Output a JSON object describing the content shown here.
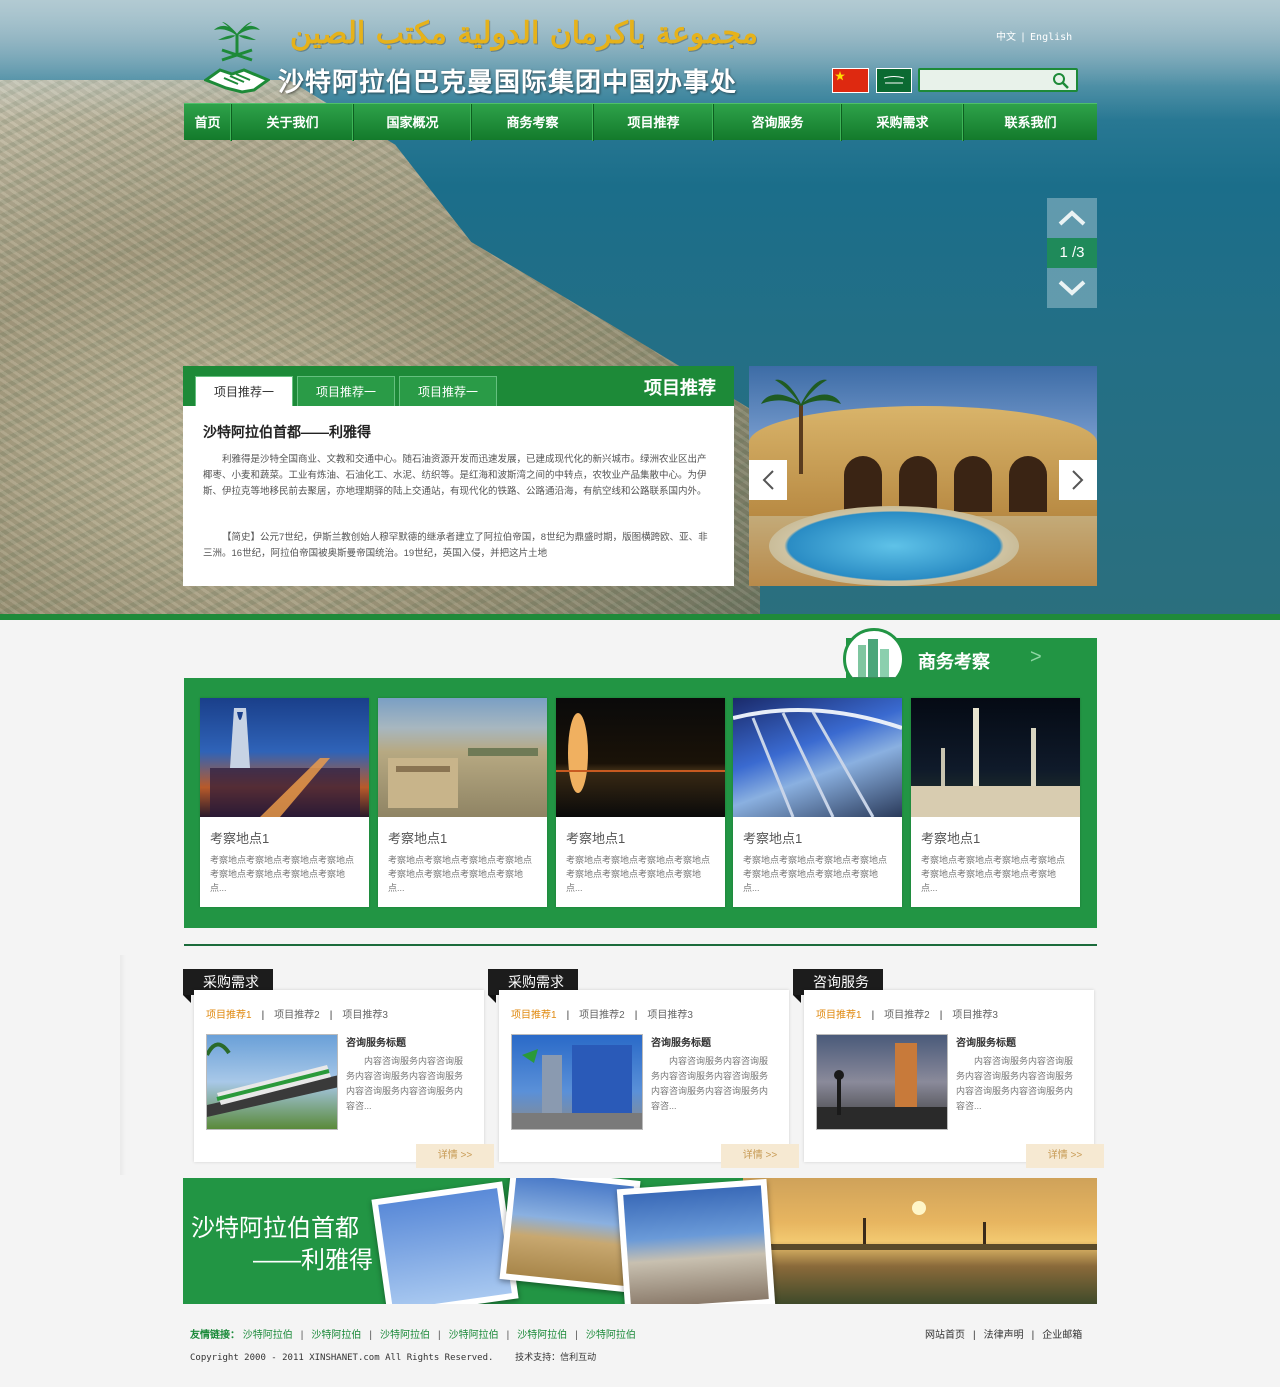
{
  "header": {
    "arabic_title": "مجموعة باكرمان الدولية مكتب الصين",
    "cn_title": "沙特阿拉伯巴克曼国际集团中国办事处",
    "lang_cn": "中文",
    "lang_sep": "|",
    "lang_en": "English",
    "search_placeholder": ""
  },
  "nav": {
    "items": [
      "首页",
      "关于我们",
      "国家概况",
      "商务考察",
      "项目推荐",
      "咨询服务",
      "采购需求",
      "联系我们"
    ]
  },
  "slider": {
    "counter": "1 /3"
  },
  "project": {
    "tabs": [
      "项目推荐一",
      "项目推荐一",
      "项目推荐一"
    ],
    "heading": "项目推荐",
    "title": "沙特阿拉伯首都——利雅得",
    "para1": "利雅得是沙特全国商业、文教和交通中心。随石油资源开发而迅速发展，已建成现代化的新兴城市。绿洲农业区出产椰枣、小麦和蔬菜。工业有炼油、石油化工、水泥、纺织等。是红海和波斯湾之间的中转点，农牧业产品集散中心。为伊斯、伊拉克等地移民前去聚居，亦地理期驿的陆上交通站，有现代化的铁路、公路通沿海，有航空线和公路联系国内外。",
    "para2": "【简史】公元7世纪，伊斯兰教创始人穆罕默德的继承者建立了阿拉伯帝国，8世纪为鼎盛时期，版图横跨欧、亚、非三洲。16世纪，阿拉伯帝国被奥斯曼帝国统治。19世纪，英国入侵，并把这片土地"
  },
  "business": {
    "title": "商务考察",
    "more": ">",
    "cards": [
      {
        "caption": "考察地点1",
        "desc": "考察地点考察地点考察地点考察地点考察地点考察地点考察地点考察地点..."
      },
      {
        "caption": "考察地点1",
        "desc": "考察地点考察地点考察地点考察地点考察地点考察地点考察地点考察地点..."
      },
      {
        "caption": "考察地点1",
        "desc": "考察地点考察地点考察地点考察地点考察地点考察地点考察地点考察地点..."
      },
      {
        "caption": "考察地点1",
        "desc": "考察地点考察地点考察地点考察地点考察地点考察地点考察地点考察地点..."
      },
      {
        "caption": "考察地点1",
        "desc": "考察地点考察地点考察地点考察地点考察地点考察地点考察地点考察地点..."
      }
    ]
  },
  "columns": [
    {
      "tag": "采购需求",
      "tabs": [
        "项目推荐1",
        "项目推荐2",
        "项目推荐3"
      ],
      "sep": "|",
      "subtitle": "咨询服务标题",
      "text": "内容咨询服务内容咨询服务内容咨询服务内容咨询服务内容咨询服务内容咨询服务内容咨...",
      "more": "详情 >>"
    },
    {
      "tag": "采购需求",
      "tabs": [
        "项目推荐1",
        "项目推荐2",
        "项目推荐3"
      ],
      "sep": "|",
      "subtitle": "咨询服务标题",
      "text": "内容咨询服务内容咨询服务内容咨询服务内容咨询服务内容咨询服务内容咨询服务内容咨...",
      "more": "详情 >>"
    },
    {
      "tag": "咨询服务",
      "tabs": [
        "项目推荐1",
        "项目推荐2",
        "项目推荐3"
      ],
      "sep": "|",
      "subtitle": "咨询服务标题",
      "text": "内容咨询服务内容咨询服务内容咨询服务内容咨询服务内容咨询服务内容咨询服务内容咨...",
      "more": "详情 >>"
    }
  ],
  "banner": {
    "line1": "沙特阿拉伯首都",
    "line2": "——利雅得"
  },
  "footer": {
    "links_label": "友情链接：",
    "links": [
      "沙特阿拉伯",
      "沙特阿拉伯",
      "沙特阿拉伯",
      "沙特阿拉伯",
      "沙特阿拉伯",
      "沙特阿拉伯"
    ],
    "sep": "|",
    "right_links": [
      "网站首页",
      "法律声明",
      "企业邮箱"
    ],
    "copyright": "Copyright  2000 - 2011 XINSHANET.com  All Rights Reserved.",
    "support": "技术支持：信利互动"
  },
  "colors": {
    "brand_green": "#229544",
    "nav_green": "#1d8a38",
    "accent_orange": "#e08a10",
    "title_gold": "#e6b21a"
  }
}
